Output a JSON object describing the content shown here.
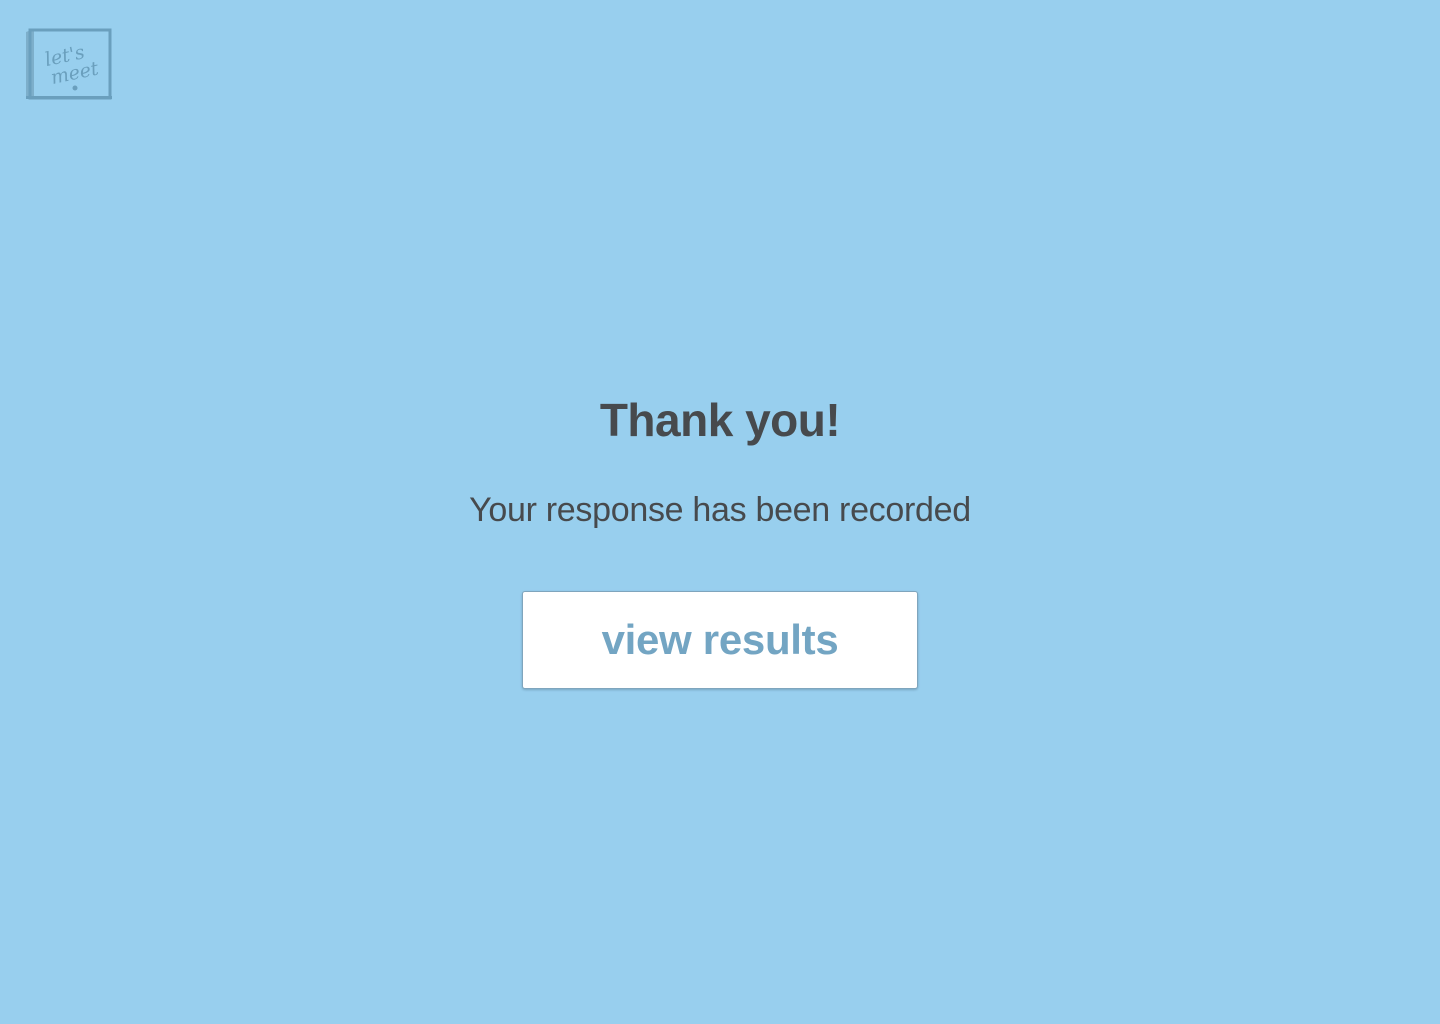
{
  "logo": {
    "text_line1": "let's",
    "text_line2": "meet",
    "icon": "calendar-card-logo",
    "color": "#6A9FBD"
  },
  "main": {
    "title": "Thank you!",
    "message": "Your response has been recorded",
    "view_results_label": "view results"
  },
  "colors": {
    "background": "#98CFEE",
    "text": "#474A4D",
    "button_text": "#73A5C3",
    "button_bg": "#FFFFFF"
  }
}
